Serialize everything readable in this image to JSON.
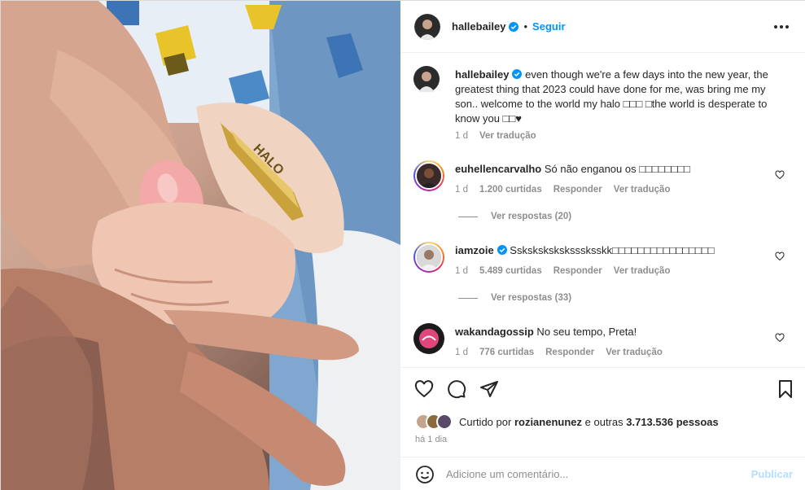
{
  "post": {
    "username": "hallebailey",
    "follow_label": "Seguir",
    "separator": "•",
    "caption_user": "hallebailey",
    "caption_text": " even though we're a few days into the new year, the greatest thing that 2023 could have done for me, was bring me my son.. welcome to the world my halo □□□ □the world is desperate to know you □□♥",
    "caption_time": "1 d",
    "caption_translate": "Ver tradução",
    "bracelet_text": "HALO"
  },
  "comments": [
    {
      "user": "euhellencarvalho",
      "text": " Só não enganou os □□□□□□□□",
      "time": "1 d",
      "likes": "1.200 curtidas",
      "reply": "Responder",
      "translate": "Ver tradução",
      "view_replies": "Ver respostas (20)"
    },
    {
      "user": "iamzoie",
      "text": " Ssksksksksksssksskk□□□□□□□□□□□□□□□□",
      "time": "1 d",
      "likes": "5.489 curtidas",
      "reply": "Responder",
      "translate": "Ver tradução",
      "view_replies": "Ver respostas (33)"
    },
    {
      "user": "wakandagossip",
      "text": " No seu tempo, Preta!",
      "time": "1 d",
      "likes": "776 curtidas",
      "reply": "Responder",
      "translate": "Ver tradução"
    }
  ],
  "likes_line": {
    "prefix": "Curtido por ",
    "user": "rozianenunez",
    "middle": " e outras ",
    "count": "3.713.536 pessoas"
  },
  "time_ago": "há 1 dia",
  "add_comment": {
    "placeholder": "Adicione um comentário...",
    "publish_label": "Publicar"
  },
  "icons": {
    "more": "more-options-icon",
    "like": "heart-icon",
    "comment": "comment-icon",
    "share": "share-icon",
    "save": "bookmark-icon",
    "emoji": "emoji-icon",
    "verified": "verified-badge-icon"
  },
  "colors": {
    "link": "#0095f6",
    "muted": "#8e8e8e",
    "publish_disabled": "#b2dffc"
  }
}
